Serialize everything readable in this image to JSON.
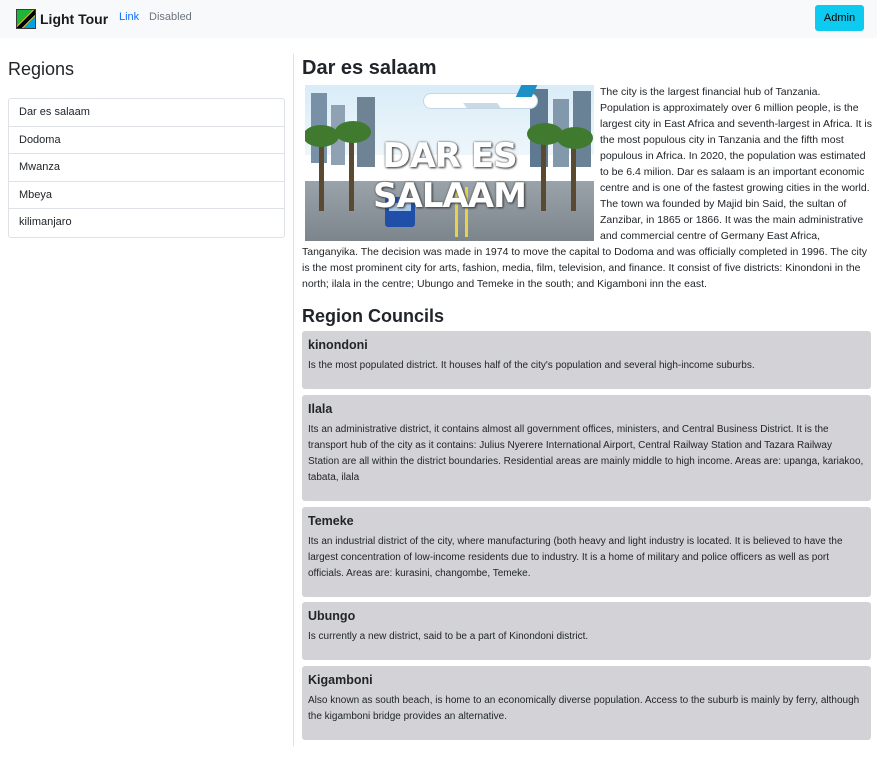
{
  "navbar": {
    "brand": "Light Tour",
    "links": [
      "Link",
      "Disabled"
    ],
    "admin_label": "Admin"
  },
  "sidebar": {
    "title": "Regions",
    "items": [
      "Dar es salaam",
      "Dodoma",
      "Mwanza",
      "Mbeya",
      "kilimanjaro"
    ]
  },
  "city": {
    "title": "Dar es salaam",
    "image_caption": "DAR ES SALAAM",
    "description": "The city is the largest financial hub of Tanzania. Population is approximately over 6 million people, is the largest city in East Africa and seventh-largest in Africa. It is the most populous city in Tanzania and the fifth most populous in Africa. In 2020, the population was estimated to be 6.4 milion. Dar es salaam is an important economic centre and is one of the fastest growing cities in the world. The town wa founded by Majid bin Said, the sultan of Zanzibar, in 1865 or 1866. It was the main administrative and commercial centre of Germany East Africa, Tanganyika. The decision was made in 1974 to move the capital to Dodoma and was officially completed in 1996. The city is the most prominent city for arts, fashion, media, film, television, and finance. It consist of five districts: Kinondoni in the north; ilala in the centre; Ubungo and Temeke in the south; and Kigamboni inn the east."
  },
  "councils": {
    "title": "Region Councils",
    "items": [
      {
        "name": "kinondoni",
        "description": "Is the most populated district. It houses half of the city's population and several high-income suburbs."
      },
      {
        "name": "Ilala",
        "description": "Its an administrative district, it contains almost all government offices, ministers, and Central Business District. It is the transport hub of the city as it contains: Julius Nyerere International Airport, Central Railway Station and Tazara Railway Station are all within the district boundaries. Residential areas are mainly middle to high income. Areas are: upanga, kariakoo, tabata, ilala"
      },
      {
        "name": "Temeke",
        "description": "Its an industrial district of the city, where manufacturing (both heavy and light industry is located. It is believed to have the largest concentration of low-income residents due to industry. It is a home of military and police officers as well as port officials. Areas are: kurasini, changombe, Temeke."
      },
      {
        "name": "Ubungo",
        "description": "Is currently a new district, said to be a part of Kinondoni district."
      },
      {
        "name": "Kigamboni",
        "description": "Also known as south beach, is home to an economically diverse population. Access to the suburb is mainly by ferry, although the kigamboni bridge provides an alternative."
      }
    ]
  }
}
